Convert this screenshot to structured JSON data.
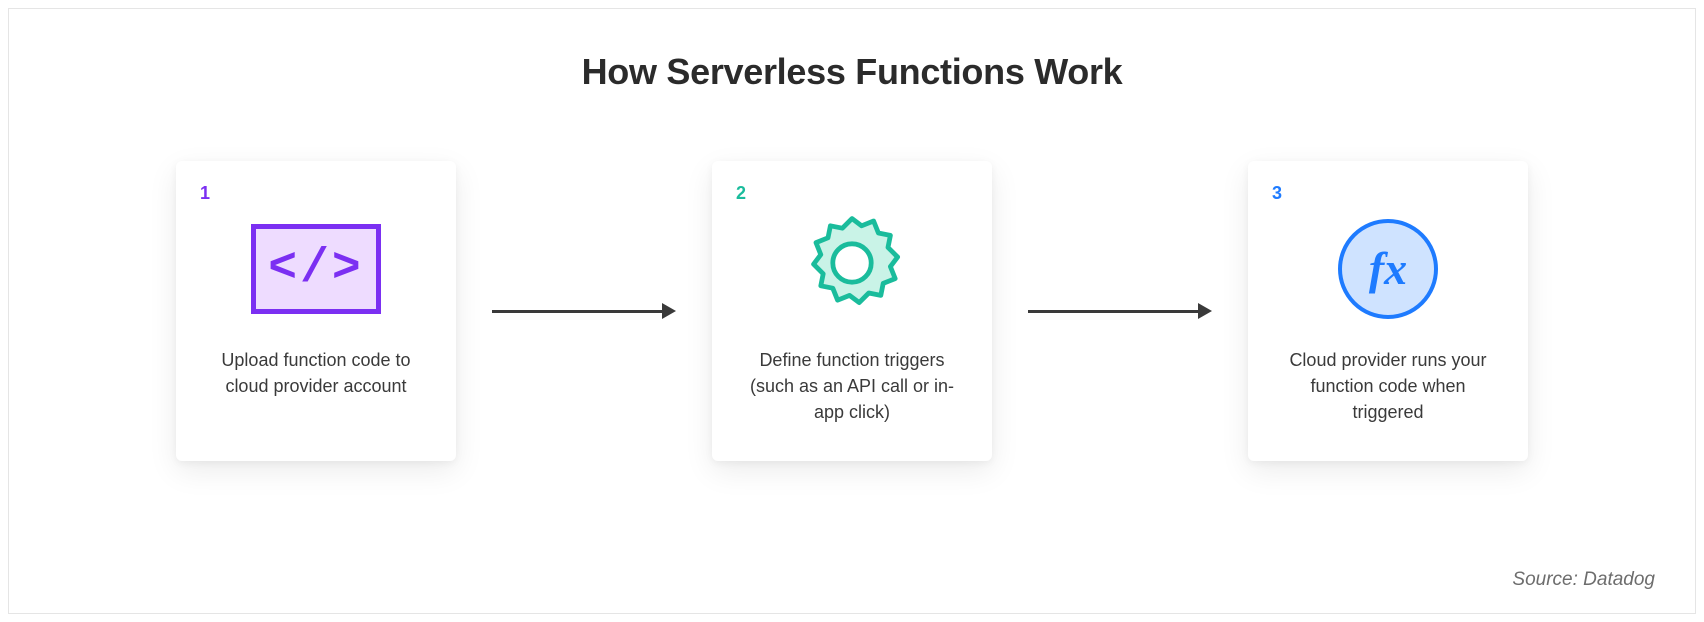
{
  "title": "How Serverless Functions Work",
  "steps": [
    {
      "num": "1",
      "num_color": "#7b2ff2",
      "icon": "code-icon",
      "caption": "Upload function code to cloud provider account"
    },
    {
      "num": "2",
      "num_color": "#1abc9c",
      "icon": "gear-icon",
      "caption": "Define function triggers (such as an API call or in-app click)"
    },
    {
      "num": "3",
      "num_color": "#1e7bff",
      "icon": "fx-icon",
      "caption": "Cloud provider runs your function code when triggered"
    }
  ],
  "source": "Source: Datadog",
  "colors": {
    "purple": "#7b2ff2",
    "purple_fill": "#eedcff",
    "teal": "#1abc9c",
    "teal_fill": "#c9f3e7",
    "blue": "#1e7bff",
    "blue_fill": "#cfe3ff",
    "arrow": "#3a3a3a"
  }
}
